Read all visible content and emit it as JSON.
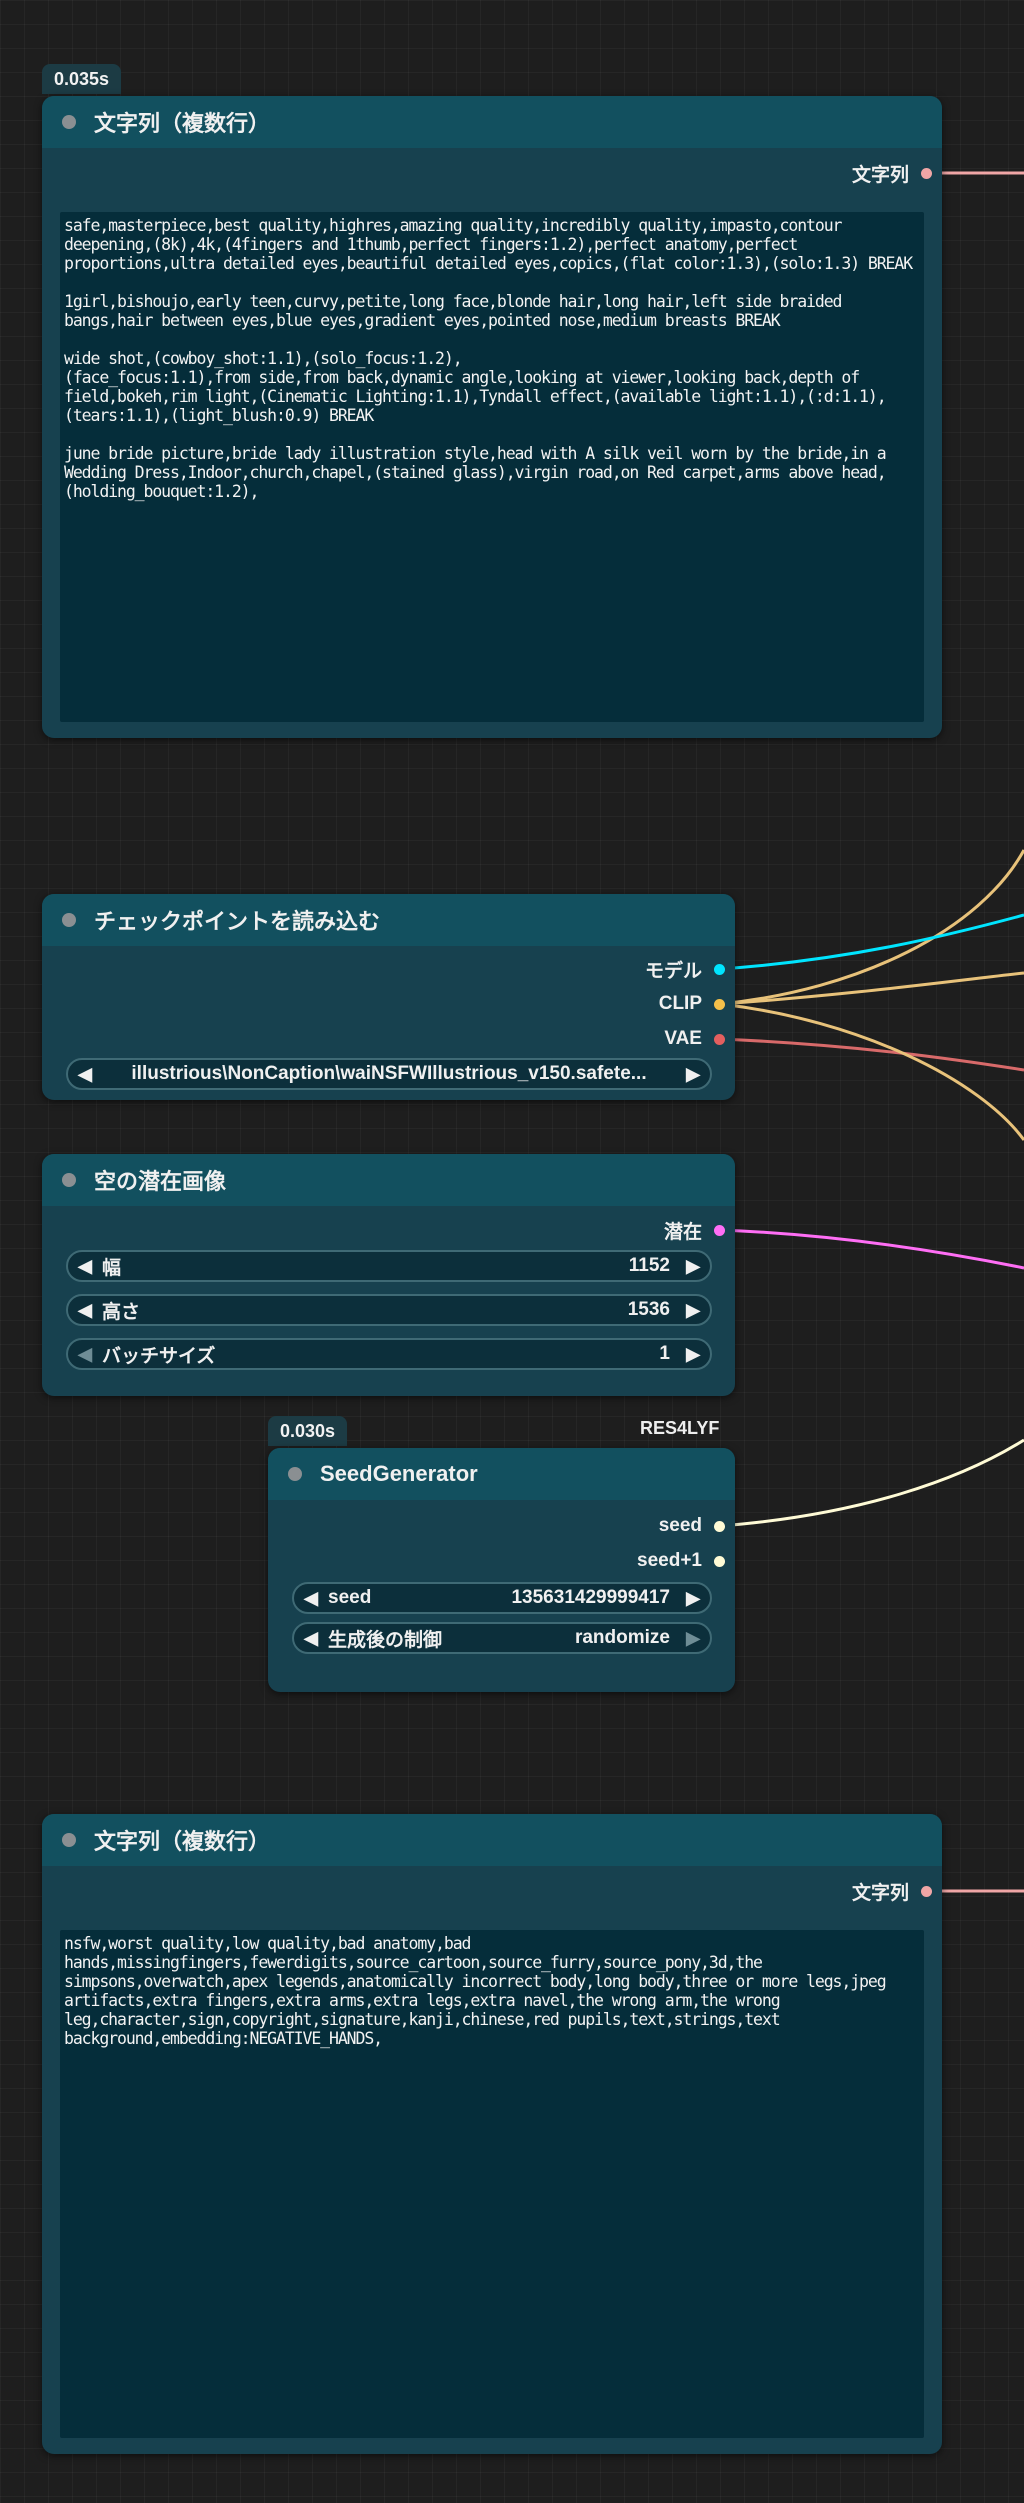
{
  "colors": {
    "model": "#00e5ff",
    "clip": "#f5c04a",
    "vae": "#e35f5f",
    "latent": "#ff6ef5",
    "seed": "#fffbd6",
    "string": "#f0a6a6"
  },
  "node_top_text": {
    "timing": "0.035s",
    "title": "文字列（複数行）",
    "output_label": "文字列",
    "text": "safe,masterpiece,best quality,highres,amazing quality,incredibly quality,impasto,contour deepening,(8k),4k,(4fingers and 1thumb,perfect fingers:1.2),perfect anatomy,perfect proportions,ultra detailed eyes,beautiful detailed eyes,copics,(flat color:1.3),(solo:1.3) BREAK\n\n1girl,bishoujo,early teen,curvy,petite,long face,blonde hair,long hair,left side braided bangs,hair between eyes,blue eyes,gradient eyes,pointed nose,medium breasts BREAK\n\nwide shot,(cowboy_shot:1.1),(solo_focus:1.2),\n(face_focus:1.1),from side,from back,dynamic angle,looking at viewer,looking back,depth of field,bokeh,rim light,(Cinematic Lighting:1.1),Tyndall effect,(available light:1.1),(:d:1.1),(tears:1.1),(light_blush:0.9) BREAK\n\njune bride picture,bride lady illustration style,head with A silk veil worn by the bride,in a Wedding Dress,Indoor,church,chapel,(stained glass),virgin road,on Red carpet,arms above head,(holding_bouquet:1.2),"
  },
  "node_checkpoint": {
    "title": "チェックポイントを読み込む",
    "outputs": [
      "モデル",
      "CLIP",
      "VAE"
    ],
    "ckpt_name": "illustrious\\NonCaption\\waiNSFWIllustrious_v150.safete..."
  },
  "node_latent": {
    "title": "空の潜在画像",
    "output_label": "潜在",
    "width_label": "幅",
    "width_value": "1152",
    "height_label": "高さ",
    "height_value": "1536",
    "batch_label": "バッチサイズ",
    "batch_value": "1"
  },
  "node_seed": {
    "timing": "0.030s",
    "badge": "RES4LYF",
    "title": "SeedGenerator",
    "outputs": [
      "seed",
      "seed+1"
    ],
    "seed_label": "seed",
    "seed_value": "135631429999417",
    "control_label": "生成後の制御",
    "control_value": "randomize"
  },
  "node_bottom_text": {
    "title": "文字列（複数行）",
    "output_label": "文字列",
    "text": "nsfw,worst quality,low quality,bad anatomy,bad hands,missingfingers,fewerdigits,source_cartoon,source_furry,source_pony,3d,the simpsons,overwatch,apex legends,anatomically incorrect body,long body,three or more legs,jpeg artifacts,extra fingers,extra arms,extra legs,extra navel,the wrong arm,the wrong leg,character,sign,copyright,signature,kanji,chinese,red pupils,text,strings,text background,embedding:NEGATIVE_HANDS,"
  }
}
